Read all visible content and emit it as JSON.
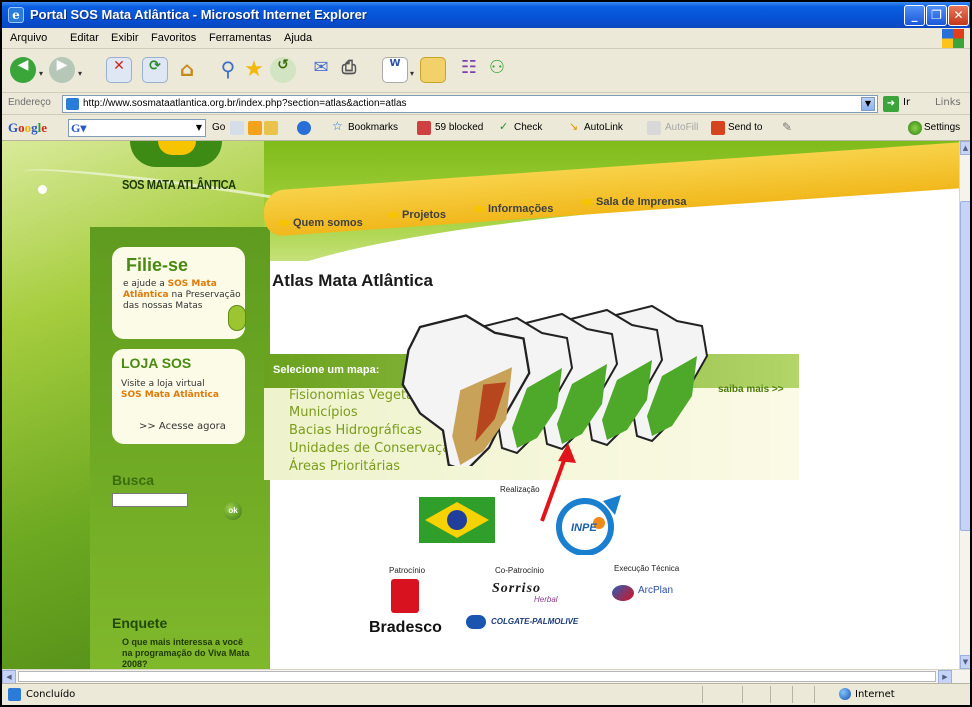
{
  "window": {
    "title": "Portal SOS Mata Atlântica - Microsoft Internet Explorer"
  },
  "menu": [
    "Arquivo",
    "Editar",
    "Exibir",
    "Favoritos",
    "Ferramentas",
    "Ajuda"
  ],
  "address": {
    "label": "Endereço",
    "url": "http://www.sosmataatlantica.org.br/index.php?section=atlas&action=atlas",
    "go_label": "Ir",
    "links_label": "Links"
  },
  "google_toolbar": {
    "logo": "Google",
    "go_label": "Go",
    "bookmarks": "Bookmarks",
    "blocked": "59 blocked",
    "check": "Check",
    "autolink": "AutoLink",
    "autofill": "AutoFill",
    "send_to": "Send to",
    "settings": "Settings"
  },
  "site": {
    "logo_text": "SOS MATA ATLÂNTICA",
    "nav": [
      "Quem somos",
      "Projetos",
      "Informações",
      "Sala de Imprensa"
    ],
    "filie": {
      "title": "Filie-se",
      "line1": "e ajude a",
      "highlight": "SOS Mata Atlântica",
      "line2": "na Preservação das nossas Matas"
    },
    "loja": {
      "title": "LOJA SOS",
      "line1": "Visite a loja virtual",
      "line2": "SOS Mata Atlântica",
      "link": ">> Acesse agora"
    },
    "busca": {
      "title": "Busca",
      "button": "ok"
    },
    "enquete": {
      "title": "Enquete",
      "question": "O que mais interessa a você na programação do Viva Mata 2008?"
    },
    "page_title": "Atlas Mata Atlântica",
    "select_label": "Selecione um mapa:",
    "maps": [
      "Fisionomias Vegetais",
      "Municípios",
      "Bacias Hidrográficas",
      "Unidades de Conservação",
      "Áreas Prioritárias"
    ],
    "saiba_mais": "saiba mais >>",
    "credits": {
      "realizacao": "Realização",
      "patrocinio": "Patrocínio",
      "copatrocinio": "Co-Patrocínio",
      "execucao": "Execução Técnica",
      "inpe": "INPE",
      "bradesco": "Bradesco",
      "sorriso": "Sorriso",
      "sorriso_sub": "Herbal",
      "colgate": "COLGATE-PALMOLIVE",
      "arcplan": "ArcPlan"
    }
  },
  "status": {
    "text": "Concluído",
    "zone": "Internet"
  }
}
